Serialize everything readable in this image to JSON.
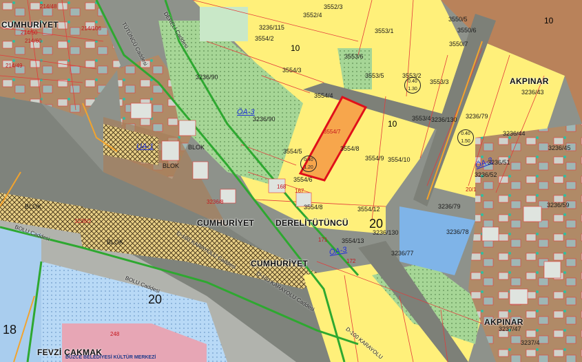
{
  "colors": {
    "residential": "#fff07a",
    "commercial_brown": "#b9825a",
    "park_green": "#9fd38f",
    "water_blue": "#8fc4f2",
    "road_gray": "#8d9089",
    "parcel_red": "#e33a3a",
    "highlight_orange": "#f7a64c",
    "boundary_green": "#2ea830"
  },
  "neighborhoods": {
    "cumhuriyet_top": "CUMHURİYET",
    "cumhuriyet_mid": "CUMHURİYET",
    "cumhuriyet_low": "CUMHURİYET",
    "derelitutuncu": "DERELİTÜTÜNCÜ",
    "akpinar_top": "AKPINAR",
    "akpinar_bottom": "AKPINAR",
    "fevzi_cakmak": "FEVZİ ÇAKMAK",
    "duzce_belediyesi": "DÜZCE BELEDİYESİ KÜLTÜR MERKEZİ"
  },
  "roads": {
    "d100_a": "D-100 KARAYOLU Caddesi",
    "d100_b": "D-100 KARAYOLU Caddesi",
    "bolu_a": "BOLU Caddesi",
    "bolu_b": "BOLU Caddesi",
    "tutuncu": "TÜTÜNCÜ Caddesi",
    "dereli": "DERELİ Caddesi",
    "d100_c": "D-100 KARAYOLU"
  },
  "zones": {
    "oa3_main": "ÖA-3",
    "oa3_low": "ÖA-3",
    "ua1": "UA-1",
    "oa3_right": "ÖA-3"
  },
  "heights": {
    "h20_center": "20",
    "h20_left": "20",
    "h10_a": "10",
    "h10_b": "10",
    "h10_c": "10",
    "h18": "18"
  },
  "parcels": {
    "p3552_3": "3552/3",
    "p3552_4": "3552/4",
    "p3553_1": "3553/1",
    "p3550_5": "3550/5",
    "p3550_6": "3550/6",
    "p3550_7": "3550/7",
    "p3236_115": "3236/115",
    "p3554_2": "3554/2",
    "p3554_3": "3554/3",
    "p3553_6": "3553/6",
    "p3553_5": "3553/5",
    "p3553_2": "3553/2",
    "p3553_3": "3553/3",
    "p3236_43": "3236/43",
    "p3236_90a": "3236/90",
    "p3236_90b": "3236/90",
    "p3554_4": "3554/4",
    "p3553_4": "3553/4",
    "p3236_130a": "3236/130",
    "p3236_79a": "3236/79",
    "p3236_44": "3236/44",
    "p3554_7": "3554/7",
    "p3554_8": "3554/8",
    "p3554_5": "3554/5",
    "p3554_9": "3554/9",
    "p3554_10": "3554/10",
    "p3554_6": "3554/6",
    "p3236_45": "3236/45",
    "p3236_52": "3236/52",
    "p3236_51": "3236/51",
    "p3554_8b": "3554/8",
    "p3554_12": "3554/12",
    "p3236_79b": "3236/79",
    "p3236_78": "3236/78",
    "p3236_130b": "3236/130",
    "p3554_13": "3554/13",
    "p3236_77": "3236/77",
    "p3236_59": "3236/59",
    "p3236_47": "3237/47",
    "p3237_4": "3237/4",
    "p214_48": "214/48",
    "p214_106": "214/106",
    "p214_50": "214/50",
    "p214_60": "214/60",
    "p214_49": "214/49",
    "p3238_2": "3238/2",
    "p3236_8": "3236/8",
    "p1_blok": "BLOK",
    "p2_blok": "BLOK",
    "p3_blok": "BLOK",
    "p4_blok": "BLOK",
    "parcel_num_248": "248",
    "parcel_num_171": "171",
    "parcel_num_167": "167",
    "parcel_num_168": "168",
    "parcel_num_172": "172",
    "parcel_num_20_1": "20/1"
  },
  "density": {
    "d_040_120": "0.40",
    "d_120": "1.20",
    "d_130": "1.30",
    "d_150": "1.50"
  }
}
